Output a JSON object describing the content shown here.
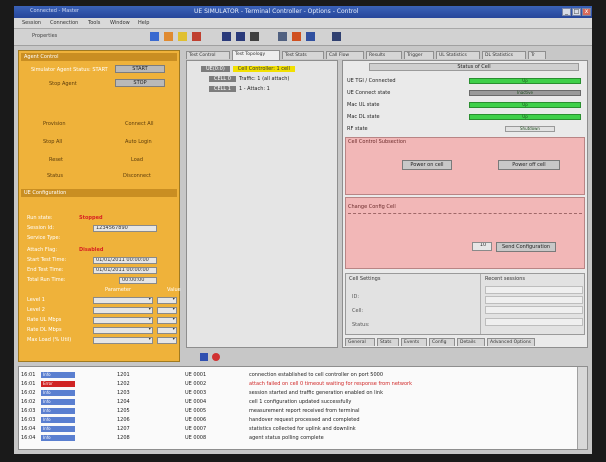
{
  "window": {
    "title": "UE SIMULATOR - Terminal Controller - Options - Control",
    "left_title": "Connected - Master",
    "buttons": [
      "_",
      "□",
      "x"
    ]
  },
  "menu": [
    "Session",
    "Connection",
    "Tools",
    "Window",
    "Help"
  ],
  "toolbar": {
    "label": "Properties",
    "icons": [
      "save-icon",
      "open-icon",
      "folder-icon",
      "print-icon",
      "monitor-icon",
      "network-icon",
      "lock-icon",
      "key-icon",
      "play-icon",
      "chart-icon"
    ]
  },
  "left_panel": {
    "section1_title": "Agent Control",
    "state_label": "Simulator Agent Status: START",
    "start_btn": "START",
    "stop_label": "Stop Agent",
    "stop_btn": "STOP",
    "grid_labels": [
      "Provision",
      "Connect All",
      "Stop All",
      "Auto Login",
      "Reset",
      "Load",
      "Status",
      "Disconnect"
    ],
    "section2_title": "UE Configuration",
    "fields": [
      {
        "label": "Run state:",
        "value": "Stopped",
        "red": true
      },
      {
        "label": "Session Id:",
        "value": "1234567890"
      },
      {
        "label": "Service Type:",
        "value": ""
      },
      {
        "label": "Attach Flag:",
        "value": "Disabled",
        "red": true
      },
      {
        "label": "Start Test Time:",
        "value": "01/01/2011 00:00:00"
      },
      {
        "label": "End Test Time:",
        "value": "01/01/2011 00:00:00"
      },
      {
        "label": "Total Run Time:",
        "value": "00:00:00"
      }
    ],
    "table_headers": [
      "Parameter",
      "Value"
    ],
    "table_rows": [
      "Level 1",
      "Level 2",
      "Rate UL Mbps",
      "Rate DL Mbps",
      "Max Load (% Util)"
    ]
  },
  "tabs": [
    "Test Control",
    "Test Topology",
    "Test Stats",
    "Call Flow",
    "Results",
    "Trigger",
    "UL Statistics",
    "DL Statistics",
    "Tr"
  ],
  "tree": [
    {
      "node": "UE(0:0)",
      "label": "Cell Controller: 1 cell",
      "highlight": true
    },
    {
      "node": "CELL 0",
      "label": "Traffic: 1 (all attach)"
    },
    {
      "node": "CELL 1",
      "label": "1 - Attach: 1"
    }
  ],
  "right_panel": {
    "header": "Status of Cell",
    "status_rows": [
      {
        "label": "UE TGI / Connected",
        "bar": "Up",
        "gray": false
      },
      {
        "label": "UE Connect state",
        "bar": "Inactive",
        "gray": true
      },
      {
        "label": "Mac UL state",
        "bar": "Up",
        "gray": false
      },
      {
        "label": "Mac DL state",
        "bar": "Up",
        "gray": false
      },
      {
        "label": "RF state",
        "bar": "Shutdown",
        "gray": false
      }
    ],
    "pink1_title": "Cell Control Subsection",
    "pink1_buttons": [
      "Power on cell",
      "Power off cell"
    ],
    "pink2_title": "Change Config Cell",
    "pink2_value": "10",
    "pink2_button": "Send Configuration",
    "info_title": "Cell Settings",
    "info_labels": [
      "ID:",
      "Cell:",
      "Status:"
    ],
    "info_right_title": "Recent sessions",
    "sub_tabs": [
      "General",
      "Stats",
      "Events",
      "Config",
      "Details",
      "Advanced Options"
    ]
  },
  "log": {
    "rows": [
      {
        "time": "16:01",
        "badge": "Info",
        "red": false,
        "num": "1201",
        "id": "UE 0001",
        "msg": "connection established to cell controller on port 5000"
      },
      {
        "time": "16:01",
        "badge": "Error",
        "red": true,
        "num": "1202",
        "id": "UE 0002",
        "msg": "attach failed on cell 0 timeout waiting for response from network"
      },
      {
        "time": "16:02",
        "badge": "Info",
        "red": false,
        "num": "1203",
        "id": "UE 0003",
        "msg": "session started and traffic generation enabled on link"
      },
      {
        "time": "16:02",
        "badge": "Info",
        "red": false,
        "num": "1204",
        "id": "UE 0004",
        "msg": "cell 1 configuration updated successfully"
      },
      {
        "time": "16:03",
        "badge": "Info",
        "red": false,
        "num": "1205",
        "id": "UE 0005",
        "msg": "measurement report received from terminal"
      },
      {
        "time": "16:03",
        "badge": "Info",
        "red": false,
        "num": "1206",
        "id": "UE 0006",
        "msg": "handover request processed and completed"
      },
      {
        "time": "16:04",
        "badge": "Info",
        "red": false,
        "num": "1207",
        "id": "UE 0007",
        "msg": "statistics collected for uplink and downlink"
      },
      {
        "time": "16:04",
        "badge": "Info",
        "red": false,
        "num": "1208",
        "id": "UE 0008",
        "msg": "agent status polling complete"
      }
    ]
  }
}
